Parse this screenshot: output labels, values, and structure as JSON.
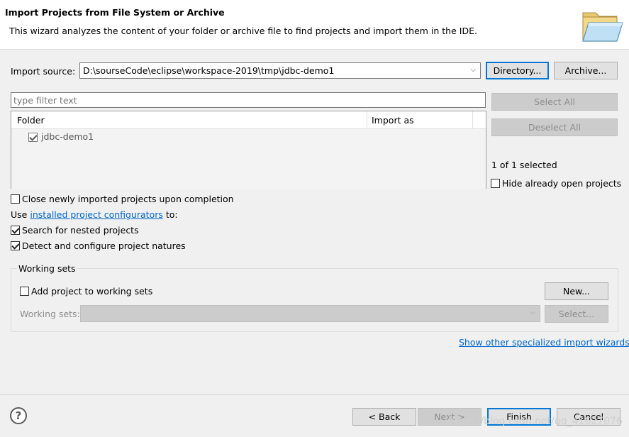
{
  "header": {
    "title": "Import Projects from File System or Archive",
    "description": "This wizard analyzes the content of your folder or archive file to find projects and import them in the IDE."
  },
  "import_source": {
    "label": "Import source:",
    "value": "D:\\sourseCode\\eclipse\\workspace-2019\\tmp\\jdbc-demo1",
    "directory_button": "Directory...",
    "archive_button": "Archive..."
  },
  "filter": {
    "placeholder": "type filter text"
  },
  "table": {
    "columns": [
      "Folder",
      "Import as"
    ],
    "rows": [
      {
        "folder": "jdbc-demo1",
        "import_as": "",
        "checked": true
      }
    ]
  },
  "side": {
    "select_all": "Select All",
    "deselect_all": "Deselect All",
    "selected_count": "1 of 1 selected",
    "hide_open": "Hide already open projects"
  },
  "options": {
    "close_imported": "Close newly imported projects upon completion",
    "use_prefix": "Use",
    "configurators_link": "installed project configurators",
    "use_suffix": "to:",
    "search_nested": "Search for nested projects",
    "detect_natures": "Detect and configure project natures"
  },
  "working_sets": {
    "group_title": "Working sets",
    "add_label": "Add project to working sets",
    "new_button": "New...",
    "sets_label": "Working sets:",
    "select_button": "Select..."
  },
  "other_wizards_link": "Show other specialized import wizards",
  "footer": {
    "back": "< Back",
    "next": "Next >",
    "finish": "Finish",
    "cancel": "Cancel",
    "watermark": "https://blog.csdn.net/qq_41627076"
  }
}
